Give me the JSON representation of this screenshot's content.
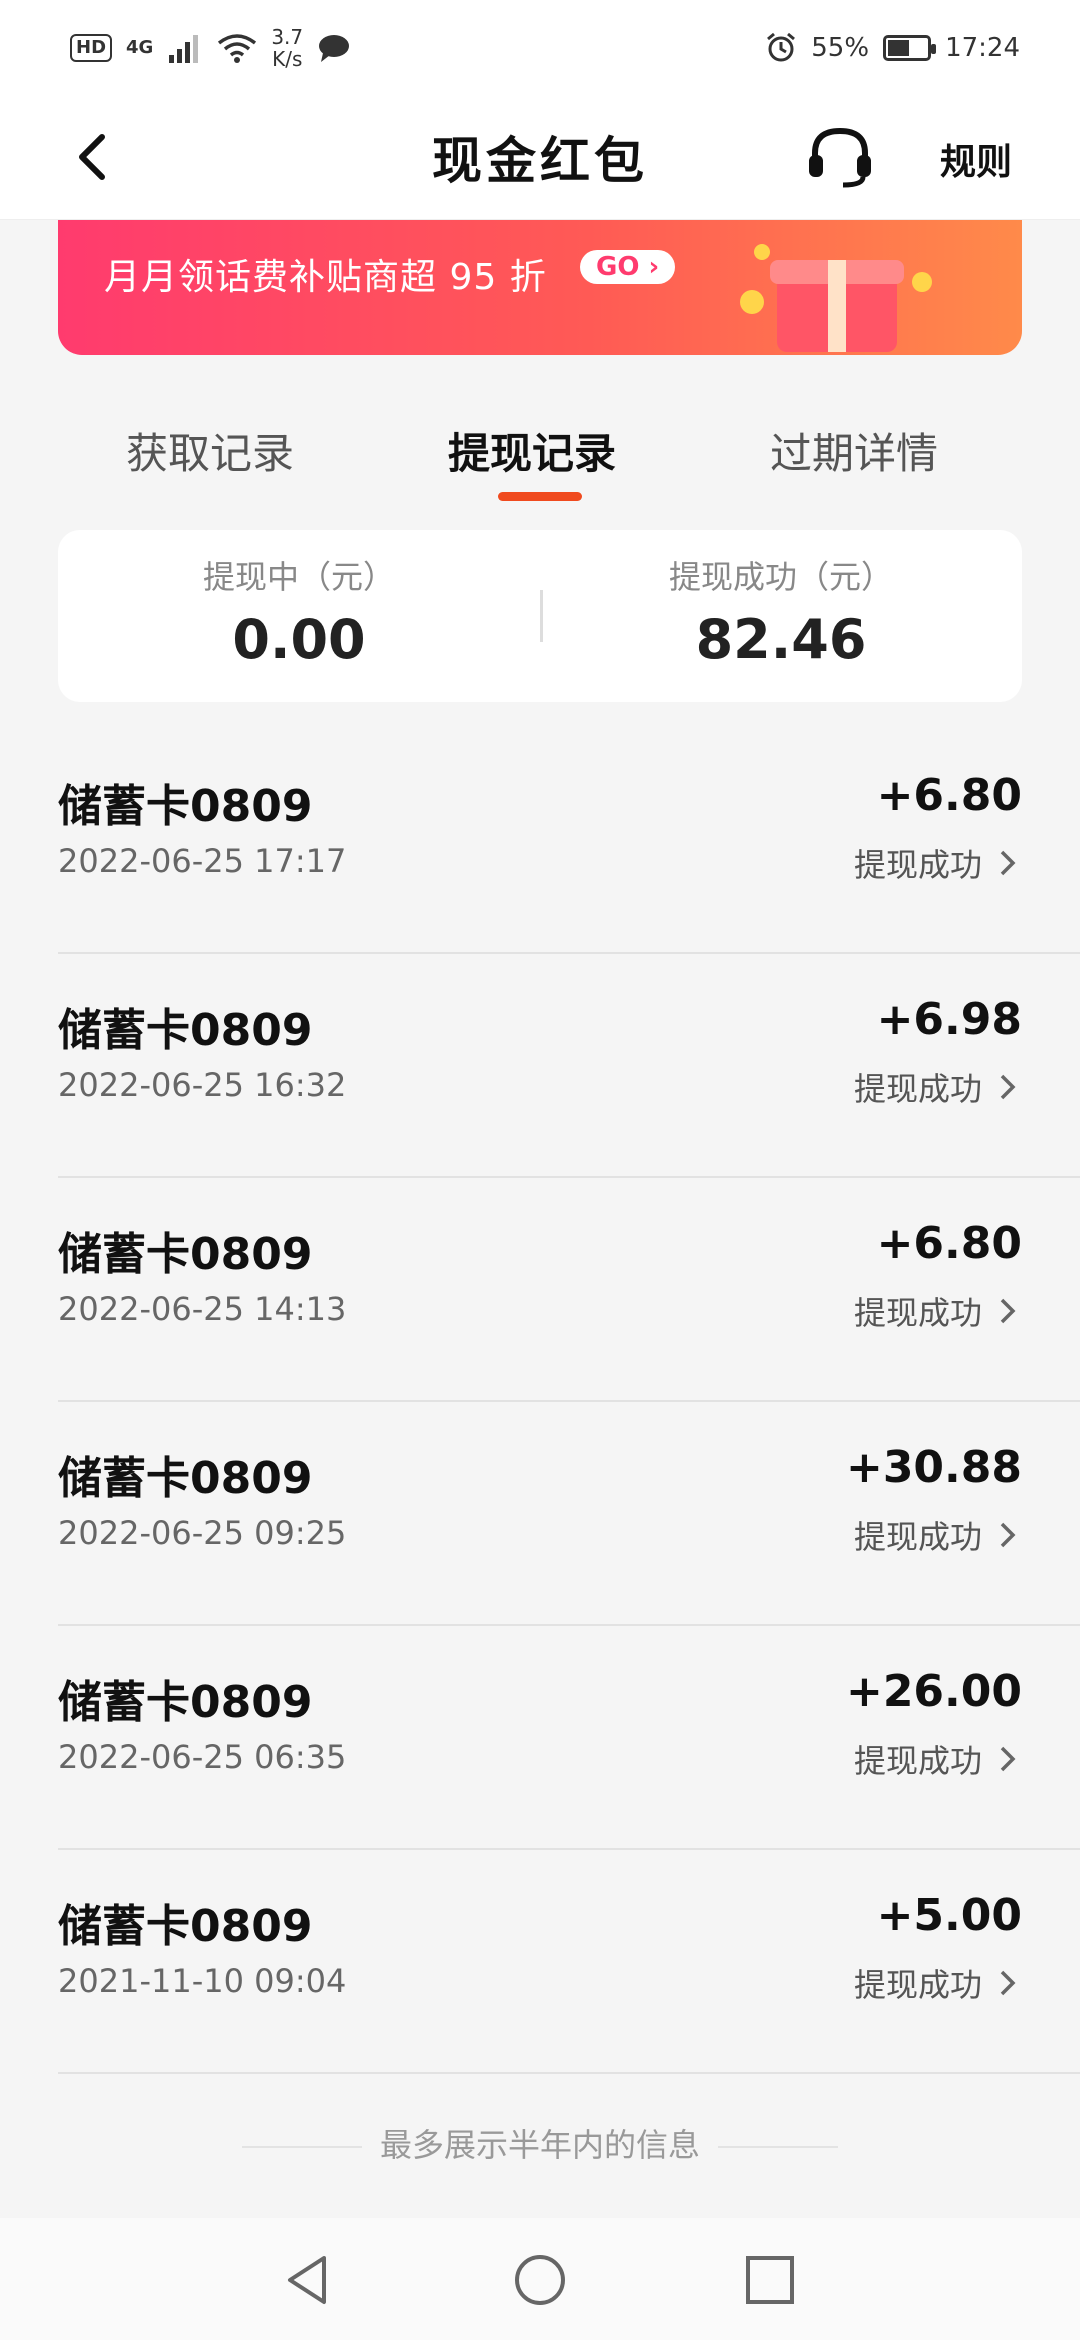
{
  "status_bar": {
    "hd": "HD",
    "network": "4G",
    "speed_value": "3.7",
    "speed_unit": "K/s",
    "battery": "55%",
    "battery_level": 0.55,
    "time": "17:24"
  },
  "nav": {
    "title": "现金红包",
    "rules_label": "规则"
  },
  "banner": {
    "text": "月月领话费补贴商超 95 折",
    "go_label": "GO"
  },
  "tabs": [
    {
      "label": "获取记录",
      "active": false
    },
    {
      "label": "提现记录",
      "active": true
    },
    {
      "label": "过期详情",
      "active": false
    }
  ],
  "summary": {
    "pending_label": "提现中（元）",
    "pending_value": "0.00",
    "success_label": "提现成功（元）",
    "success_value": "82.46"
  },
  "records": [
    {
      "title": "储蓄卡0809",
      "datetime": "2022-06-25 17:17",
      "amount": "+6.80",
      "status": "提现成功"
    },
    {
      "title": "储蓄卡0809",
      "datetime": "2022-06-25 16:32",
      "amount": "+6.98",
      "status": "提现成功"
    },
    {
      "title": "储蓄卡0809",
      "datetime": "2022-06-25 14:13",
      "amount": "+6.80",
      "status": "提现成功"
    },
    {
      "title": "储蓄卡0809",
      "datetime": "2022-06-25 09:25",
      "amount": "+30.88",
      "status": "提现成功"
    },
    {
      "title": "储蓄卡0809",
      "datetime": "2022-06-25 06:35",
      "amount": "+26.00",
      "status": "提现成功"
    },
    {
      "title": "储蓄卡0809",
      "datetime": "2021-11-10 09:04",
      "amount": "+5.00",
      "status": "提现成功"
    }
  ],
  "footer": {
    "note": "最多展示半年内的信息"
  },
  "colors": {
    "accent": "#f04a1e",
    "banner_start": "#ff3b6e",
    "banner_end": "#ff8a4a"
  }
}
